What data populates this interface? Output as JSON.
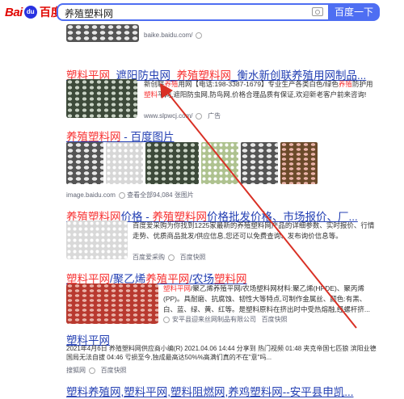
{
  "search": {
    "query": "养殖塑料网",
    "button": "百度一下"
  },
  "logo": {
    "left": "Bai",
    "right": "百度"
  },
  "r0": {
    "source": "baike.baidu.com/"
  },
  "r1": {
    "title": [
      "塑料平网",
      "_遮阳防虫网_",
      "养殖塑料网",
      "_衡水新创联养殖用网制品..."
    ],
    "snippet": [
      "新创联",
      "养殖",
      "用网【电话:198-3387-1679】专业生产各类白色/绿色",
      "养殖",
      "防护用",
      "塑料",
      "平网,遮阳防虫网,防鸟网,价格合理品质有保证,欢迎新老客户前来咨询!"
    ],
    "source": "www.slpwcj.com/",
    "tag": "广告"
  },
  "r2": {
    "title": [
      "养殖塑料网",
      " - 百度图片"
    ],
    "source": "image.baidu.com",
    "more": "查看全部94,084 张图片"
  },
  "r3": {
    "title": [
      "养殖塑料网",
      "价格 - ",
      "养殖塑料网",
      "价格批发价格、市场报价、厂..."
    ],
    "snippet": "百度爱采购为你找到1225家最新的养殖塑料网产品的详细参数、实时报价、行情走势、优质商品批发/供应信息,您还可以免费查询、发布询价信息等。",
    "source": "百度爱采购",
    "sub": "百度快照"
  },
  "r4": {
    "title": [
      "塑料平网",
      "/聚乙烯",
      "养殖平网",
      "/农场",
      "塑料网"
    ],
    "snippet": [
      "塑料平网",
      "/聚乙烯养殖平网/农场塑料网材料:聚乙烯(HPDE)、聚丙烯(PP)。具耐磨、抗腐蚀、韧性大等特点,可制作金属丝、颜色:有黑、白、蓝、绿、黄、红等。是塑料原料在挤出时中受热熔融,经螺杆挤..."
    ],
    "source": "安平县迎来丝网制品有限公司",
    "sub": "百度快照"
  },
  "r5": {
    "title": "塑料平网",
    "snippet": "2021年4月6日 养殖塑料网供应商小编(R) 2021.04.06 14:44 分享到 热门视频 01:48 夹克帝国七匹狼 滨阳业德国局无法自拔 04:46 亏损至今,独成最高达50%%高满们真的不在\"意\"吗...",
    "source": "搜狐网",
    "sub": "百度快照"
  },
  "r6": {
    "title": "塑料养殖网,塑料平网,塑料阻燃网,养鸡塑料网--安平县申凯..."
  },
  "colors": {
    "accent": "#4e6ef2",
    "title": "#2440b3",
    "highlight": "#f73131",
    "annotation": "#d93025"
  }
}
